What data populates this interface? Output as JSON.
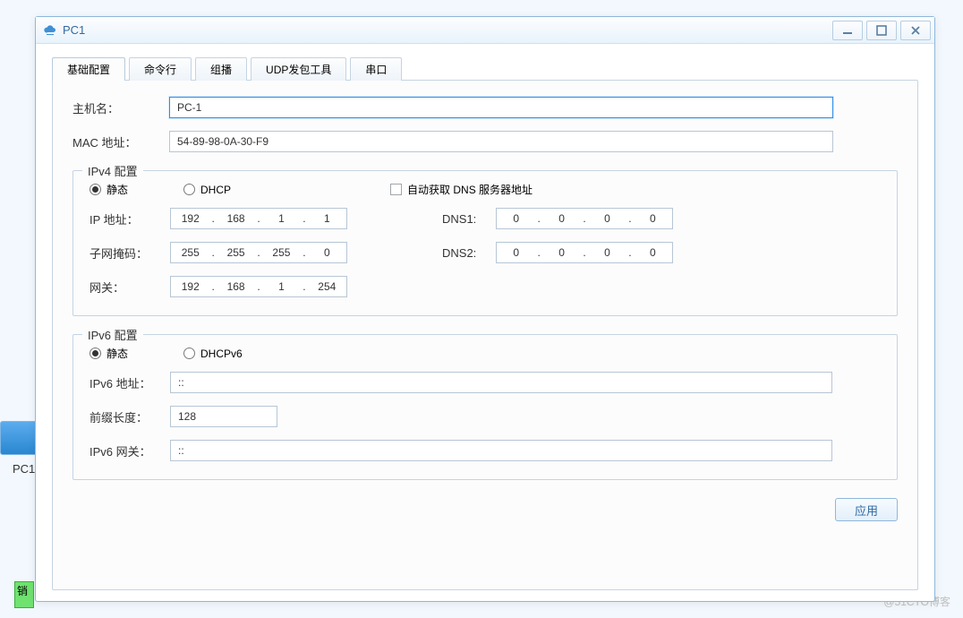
{
  "bg": {
    "pc_label": "PC1",
    "vlan_tag": "销",
    "watermark": "@51CTO博客"
  },
  "window": {
    "title": "PC1"
  },
  "tabs": {
    "basic": "基础配置",
    "cmd": "命令行",
    "mcast": "组播",
    "udp": "UDP发包工具",
    "serial": "串口"
  },
  "form": {
    "hostname_label": "主机名：",
    "hostname_value": "PC-1",
    "mac_label": "MAC 地址：",
    "mac_value": "54-89-98-0A-30-F9"
  },
  "ipv4": {
    "title": "IPv4 配置",
    "static": "静态",
    "dhcp": "DHCP",
    "auto_dns": "自动获取 DNS 服务器地址",
    "ip_label": "IP 地址：",
    "ip": {
      "o1": "192",
      "o2": "168",
      "o3": "1",
      "o4": "1"
    },
    "mask_label": "子网掩码：",
    "mask": {
      "o1": "255",
      "o2": "255",
      "o3": "255",
      "o4": "0"
    },
    "gw_label": "网关：",
    "gw": {
      "o1": "192",
      "o2": "168",
      "o3": "1",
      "o4": "254"
    },
    "dns1_label": "DNS1:",
    "dns1": {
      "o1": "0",
      "o2": "0",
      "o3": "0",
      "o4": "0"
    },
    "dns2_label": "DNS2:",
    "dns2": {
      "o1": "0",
      "o2": "0",
      "o3": "0",
      "o4": "0"
    }
  },
  "ipv6": {
    "title": "IPv6 配置",
    "static": "静态",
    "dhcpv6": "DHCPv6",
    "addr_label": "IPv6 地址：",
    "addr_value": "::",
    "prefix_label": "前缀长度：",
    "prefix_value": "128",
    "gw_label": "IPv6 网关：",
    "gw_value": "::"
  },
  "actions": {
    "apply": "应用"
  }
}
